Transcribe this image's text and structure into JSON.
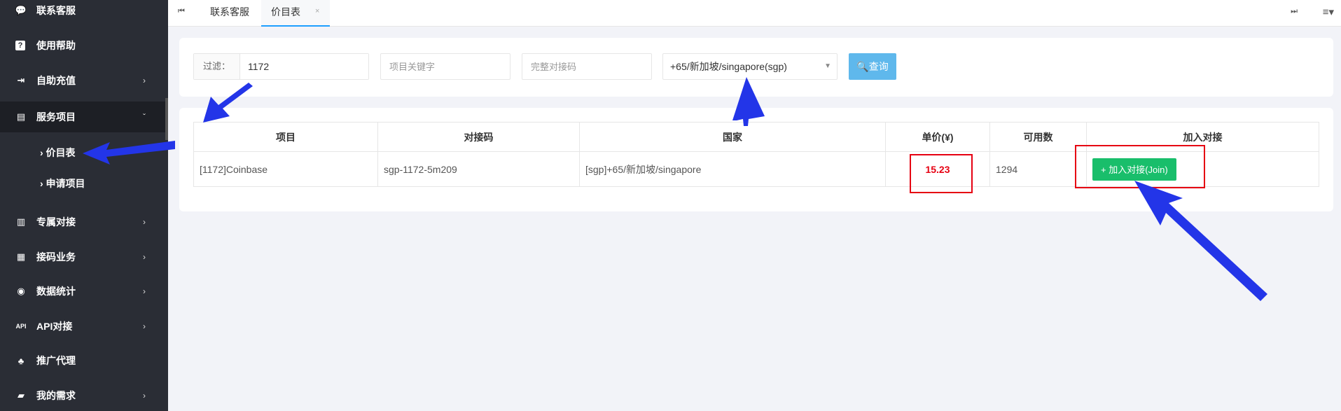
{
  "sidebar": {
    "items": [
      {
        "label": "联系客服",
        "icon": "chat-icon",
        "glyph": "💬"
      },
      {
        "label": "使用帮助",
        "icon": "help-icon",
        "glyph": "?"
      },
      {
        "label": "自助充值",
        "icon": "recharge-icon",
        "glyph": "⇥"
      },
      {
        "label": "服务项目",
        "icon": "service-icon",
        "glyph": "▤"
      },
      {
        "label": "专属对接",
        "icon": "book-icon",
        "glyph": "▥"
      },
      {
        "label": "接码业务",
        "icon": "code-icon",
        "glyph": "▦"
      },
      {
        "label": "数据统计",
        "icon": "database-icon",
        "glyph": "◉"
      },
      {
        "label": "API对接",
        "icon": "api-icon",
        "glyph": "API"
      },
      {
        "label": "推广代理",
        "icon": "sitemap-icon",
        "glyph": "♣"
      },
      {
        "label": "我的需求",
        "icon": "truck-icon",
        "glyph": "▰"
      }
    ],
    "sub_items": [
      {
        "label": "› 价目表"
      },
      {
        "label": "› 申请项目"
      }
    ]
  },
  "topbar": {
    "tabs": [
      {
        "label": "联系客服"
      },
      {
        "label": "价目表"
      }
    ],
    "close": "×",
    "first_icon": "⏮",
    "last_icon": "⏭",
    "menu_icon": "≡▾"
  },
  "search": {
    "filter_label": "过滤：",
    "filter_value": "1172",
    "keyword_placeholder": "项目关键字",
    "code_placeholder": "完整对接码",
    "country_value": "+65/新加坡/singapore(sgp)",
    "query_label": "🔍查询"
  },
  "table": {
    "headers": [
      "项目",
      "对接码",
      "国家",
      "单价(¥)",
      "可用数",
      "加入对接"
    ],
    "row": {
      "project": "[1172]Coinbase",
      "code": "sgp-1172-5m209",
      "country": "[sgp]+65/新加坡/singapore",
      "price": "15.23",
      "available": "1294",
      "join_label": "+ 加入对接(Join)"
    }
  },
  "colors": {
    "sidebar_bg": "#2a2d35",
    "accent": "#1e9fff",
    "query_btn": "#5fb8ec",
    "join_btn": "#19be6b",
    "price": "#e60012",
    "annotation_arrow": "#2335e8",
    "highlight_box": "#e60012"
  }
}
